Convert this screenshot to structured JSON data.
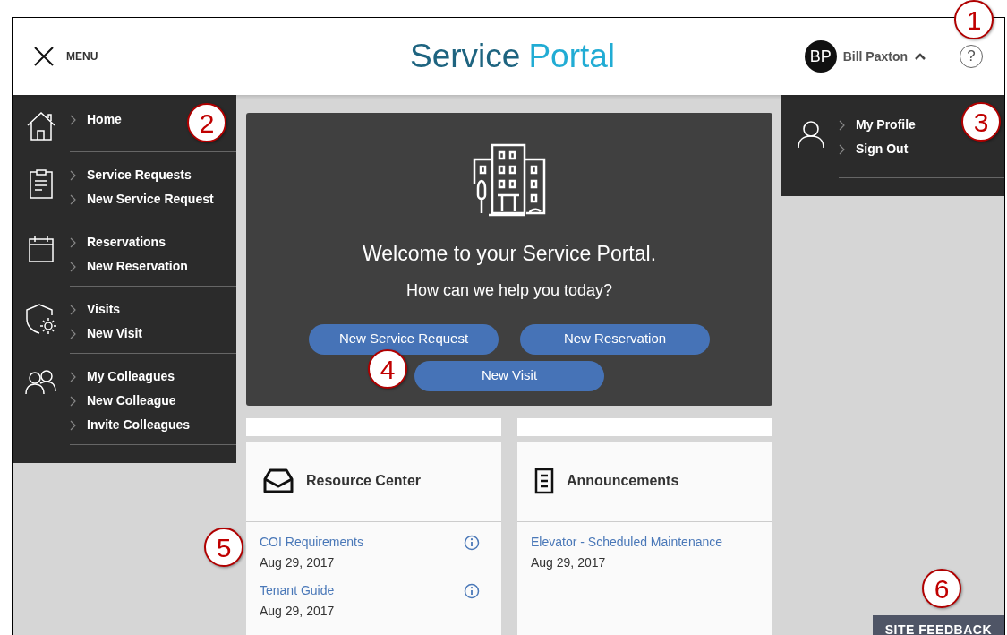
{
  "header": {
    "menu_label": "MENU",
    "brand": [
      "Service",
      "Portal"
    ],
    "user": {
      "initials": "BP",
      "name": "Bill Paxton",
      "expanded": true
    },
    "help_glyph": "?"
  },
  "sidebar": {
    "groups": [
      {
        "kind": "home",
        "links": [
          "Home"
        ]
      },
      {
        "kind": "clipboard",
        "links": [
          "Service Requests",
          "New Service Request"
        ]
      },
      {
        "kind": "calendar",
        "links": [
          "Reservations",
          "New Reservation"
        ]
      },
      {
        "kind": "shield",
        "links": [
          "Visits",
          "New Visit"
        ]
      },
      {
        "kind": "people",
        "links": [
          "My Colleagues",
          "New Colleague",
          "Invite Colleagues"
        ]
      }
    ]
  },
  "profile_menu": {
    "links": [
      "My Profile",
      "Sign Out"
    ]
  },
  "hero": {
    "title": "Welcome to your Service Portal.",
    "subtitle": "How can we help you today?",
    "buttons": [
      "New Service Request",
      "New Reservation",
      "New Visit"
    ]
  },
  "cards": [
    {
      "kind": "inbox",
      "title": "Resource Center",
      "items": [
        {
          "title": "COI Requirements",
          "date": "Aug 29, 2017",
          "info": true
        },
        {
          "title": "Tenant Guide",
          "date": "Aug 29, 2017",
          "info": true
        }
      ]
    },
    {
      "kind": "document",
      "title": "Announcements",
      "items": [
        {
          "title": "Elevator - Scheduled Maintenance",
          "date": "Aug 29, 2017",
          "info": false
        }
      ]
    }
  ],
  "feedback_button": "SITE FEEDBACK",
  "callouts": [
    "1",
    "2",
    "3",
    "4",
    "5",
    "6"
  ]
}
